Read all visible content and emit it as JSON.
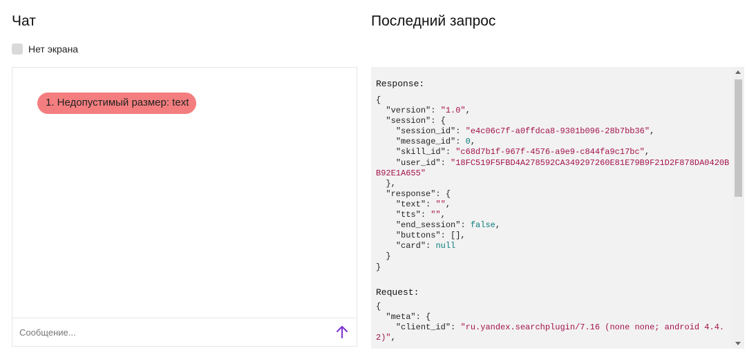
{
  "chat": {
    "title": "Чат",
    "no_screen_label": "Нет экрана",
    "no_screen_checked": false,
    "messages": [
      {
        "text": "1. Недопустимый размер: text",
        "color": "#f47e7f"
      }
    ],
    "input_placeholder": "Сообщение...",
    "send_icon": "arrow-up-icon",
    "send_icon_color": "#7b2fd1"
  },
  "last_request": {
    "title": "Последний запрос",
    "response_label": "Response:",
    "response_json": "{\n  \"version\": \"1.0\",\n  \"session\": {\n    \"session_id\": \"e4c06c7f-a0ffdca8-9301b096-28b7bb36\",\n    \"message_id\": 0,\n    \"skill_id\": \"c68d7b1f-967f-4576-a9e9-c844fa9c17bc\",\n    \"user_id\": \"18FC519F5FBD4A278592CA349297260E81E79B9F21D2F878DA0420BB92E1A655\"\n  },\n  \"response\": {\n    \"text\": \"\",\n    \"tts\": \"\",\n    \"end_session\": false,\n    \"buttons\": [],\n    \"card\": null\n  }\n}",
    "request_label": "Request:",
    "request_json": "{\n  \"meta\": {\n    \"client_id\": \"ru.yandex.searchplugin/7.16 (none none; android 4.4.2)\","
  }
}
